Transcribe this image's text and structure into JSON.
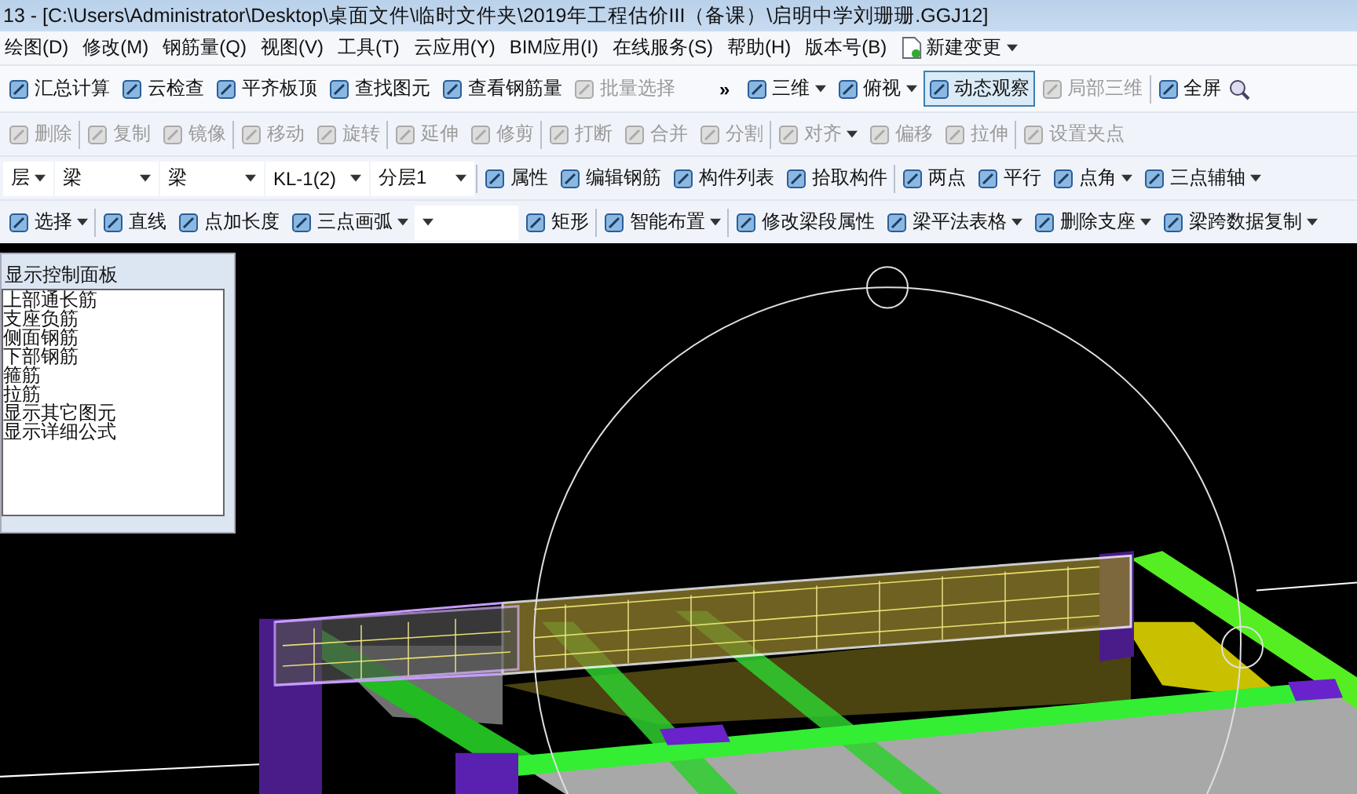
{
  "window": {
    "title": "13 - [C:\\Users\\Administrator\\Desktop\\桌面文件\\临时文件夹\\2019年工程估价III（备课）\\启明中学刘珊珊.GGJ12]"
  },
  "menu": [
    {
      "kind": "item",
      "label": "绘图(D)"
    },
    {
      "kind": "item",
      "label": "修改(M)"
    },
    {
      "kind": "item",
      "label": "钢筋量(Q)"
    },
    {
      "kind": "item",
      "label": "视图(V)"
    },
    {
      "kind": "item",
      "label": "工具(T)"
    },
    {
      "kind": "item",
      "label": "云应用(Y)"
    },
    {
      "kind": "item",
      "label": "BIM应用(I)"
    },
    {
      "kind": "item",
      "label": "在线服务(S)"
    },
    {
      "kind": "item",
      "label": "帮助(H)"
    },
    {
      "kind": "item",
      "label": "版本号(B)"
    },
    {
      "kind": "menu-button",
      "label": "新建变更"
    }
  ],
  "toolbars": [
    {
      "items": [
        {
          "kind": "button",
          "label": "汇总计算",
          "disabled": false,
          "selected": false
        },
        {
          "kind": "button",
          "label": "云检查",
          "disabled": false,
          "selected": false
        },
        {
          "kind": "button",
          "label": "平齐板顶",
          "disabled": false,
          "selected": false
        },
        {
          "kind": "button",
          "label": "查找图元",
          "disabled": false,
          "selected": false
        },
        {
          "kind": "button",
          "label": "查看钢筋量",
          "disabled": false,
          "selected": false
        },
        {
          "kind": "button",
          "label": "批量选择",
          "disabled": true,
          "selected": false
        },
        {
          "kind": "overflow",
          "label": "»"
        },
        {
          "kind": "menu-button",
          "label": "三维",
          "disabled": false,
          "selected": false
        },
        {
          "kind": "menu-button",
          "label": "俯视",
          "disabled": false,
          "selected": false
        },
        {
          "kind": "button",
          "label": "动态观察",
          "disabled": false,
          "selected": true
        },
        {
          "kind": "button",
          "label": "局部三维",
          "disabled": true,
          "selected": false
        },
        {
          "kind": "separator"
        },
        {
          "kind": "button",
          "label": "全屏",
          "disabled": false,
          "selected": false
        },
        {
          "kind": "icon"
        }
      ]
    },
    {
      "items": [
        {
          "kind": "button",
          "label": "删除",
          "disabled": true
        },
        {
          "kind": "separator"
        },
        {
          "kind": "button",
          "label": "复制",
          "disabled": true
        },
        {
          "kind": "button",
          "label": "镜像",
          "disabled": true
        },
        {
          "kind": "separator"
        },
        {
          "kind": "button",
          "label": "移动",
          "disabled": true
        },
        {
          "kind": "button",
          "label": "旋转",
          "disabled": true
        },
        {
          "kind": "separator"
        },
        {
          "kind": "button",
          "label": "延伸",
          "disabled": true
        },
        {
          "kind": "button",
          "label": "修剪",
          "disabled": true
        },
        {
          "kind": "separator"
        },
        {
          "kind": "button",
          "label": "打断",
          "disabled": true
        },
        {
          "kind": "button",
          "label": "合并",
          "disabled": true
        },
        {
          "kind": "button",
          "label": "分割",
          "disabled": true
        },
        {
          "kind": "separator"
        },
        {
          "kind": "menu-button",
          "label": "对齐",
          "disabled": true
        },
        {
          "kind": "button",
          "label": "偏移",
          "disabled": true
        },
        {
          "kind": "button",
          "label": "拉伸",
          "disabled": true
        },
        {
          "kind": "separator"
        },
        {
          "kind": "button",
          "label": "设置夹点",
          "disabled": true
        }
      ]
    },
    {
      "items": [
        {
          "kind": "combo",
          "label": "层"
        },
        {
          "kind": "combo",
          "label": "梁"
        },
        {
          "kind": "combo",
          "label": "梁"
        },
        {
          "kind": "combo",
          "label": "KL-1(2)"
        },
        {
          "kind": "combo",
          "label": "分层1"
        },
        {
          "kind": "separator"
        },
        {
          "kind": "button",
          "label": "属性",
          "disabled": false
        },
        {
          "kind": "button",
          "label": "编辑钢筋",
          "disabled": false
        },
        {
          "kind": "button",
          "label": "构件列表",
          "disabled": false
        },
        {
          "kind": "button",
          "label": "拾取构件",
          "disabled": false
        },
        {
          "kind": "separator"
        },
        {
          "kind": "button",
          "label": "两点",
          "disabled": false
        },
        {
          "kind": "button",
          "label": "平行",
          "disabled": false
        },
        {
          "kind": "menu-button",
          "label": "点角",
          "disabled": false
        },
        {
          "kind": "menu-button",
          "label": "三点辅轴",
          "disabled": false
        }
      ]
    },
    {
      "items": [
        {
          "kind": "menu-button",
          "label": "选择",
          "disabled": false
        },
        {
          "kind": "separator"
        },
        {
          "kind": "button",
          "label": "直线",
          "disabled": false
        },
        {
          "kind": "button",
          "label": "点加长度",
          "disabled": false
        },
        {
          "kind": "menu-button",
          "label": "三点画弧",
          "disabled": false
        },
        {
          "kind": "combo"
        },
        {
          "kind": "button",
          "label": "矩形",
          "disabled": false
        },
        {
          "kind": "separator"
        },
        {
          "kind": "menu-button",
          "label": "智能布置",
          "disabled": false
        },
        {
          "kind": "separator"
        },
        {
          "kind": "button",
          "label": "修改梁段属性",
          "disabled": false
        },
        {
          "kind": "menu-button",
          "label": "梁平法表格",
          "disabled": false
        },
        {
          "kind": "menu-button",
          "label": "删除支座",
          "disabled": false
        },
        {
          "kind": "menu-button",
          "label": "梁跨数据复制",
          "disabled": false
        }
      ]
    }
  ],
  "panel": {
    "title": "显示控制面板",
    "items": [
      "上部通长筋",
      "支座负筋",
      "侧面钢筋",
      "下部钢筋",
      "箍筋",
      "拉筋",
      "显示其它图元",
      "显示详细公式"
    ]
  }
}
